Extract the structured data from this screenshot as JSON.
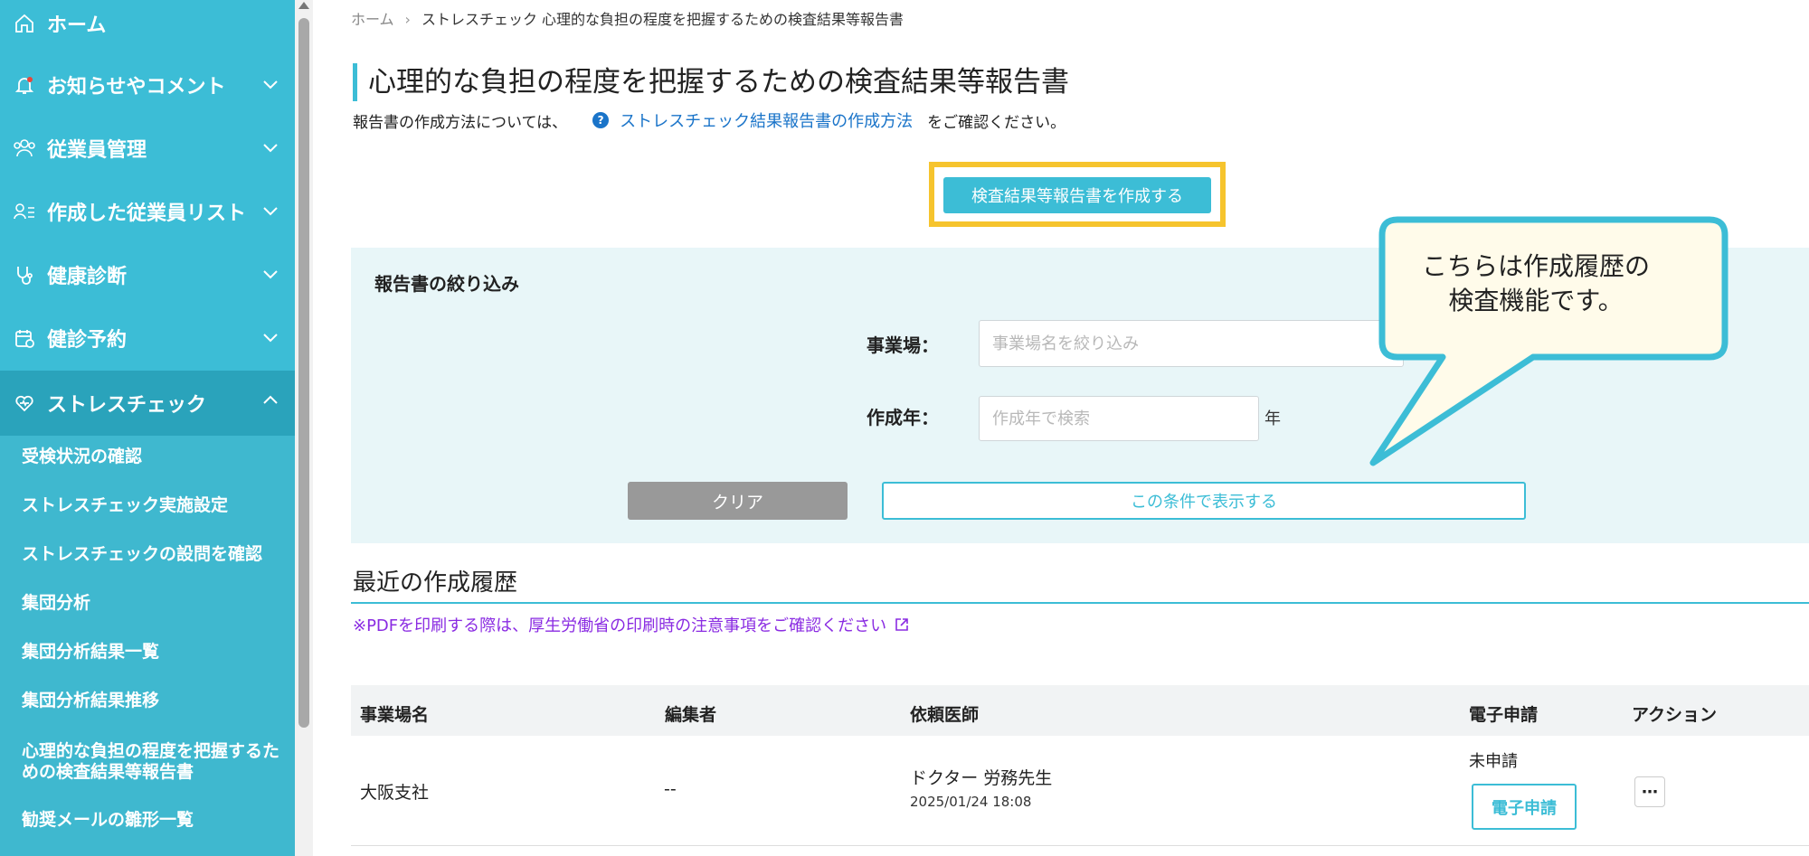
{
  "sidebar": {
    "items": [
      {
        "label": "ホーム",
        "icon": "home-icon"
      },
      {
        "label": "お知らせやコメント",
        "icon": "bell-icon"
      },
      {
        "label": "従業員管理",
        "icon": "users-icon"
      },
      {
        "label": "作成した従業員リスト",
        "icon": "user-list-icon"
      },
      {
        "label": "健康診断",
        "icon": "stethoscope-icon"
      },
      {
        "label": "健診予約",
        "icon": "calendar-icon"
      },
      {
        "label": "ストレスチェック",
        "icon": "heart-icon"
      }
    ],
    "sub_items": [
      "受検状況の確認",
      "ストレスチェック実施設定",
      "ストレスチェックの設問を確認",
      "集団分析",
      "集団分析結果一覧",
      "集団分析結果推移",
      "心理的な負担の程度を把握するための検査結果等報告書",
      "勧奨メールの雛形一覧"
    ]
  },
  "breadcrumb": {
    "home": "ホーム",
    "section": "ストレスチェック",
    "current": "心理的な負担の程度を把握するための検査結果等報告書"
  },
  "page": {
    "title": "心理的な負担の程度を把握するための検査結果等報告書",
    "intro_before": "報告書の作成方法については、",
    "intro_link": "ストレスチェック結果報告書の作成方法",
    "intro_after": "をご確認ください。",
    "create_button": "検査結果等報告書を作成する"
  },
  "filter": {
    "title": "報告書の絞り込み",
    "workplace_label": "事業場：",
    "workplace_placeholder": "事業場名を絞り込み",
    "year_label": "作成年：",
    "year_placeholder": "作成年で検索",
    "year_unit": "年",
    "clear_button": "クリア",
    "show_button": "この条件で表示する"
  },
  "callout": {
    "line1": "こちらは作成履歴の",
    "line2": "検査機能です。"
  },
  "history": {
    "title": "最近の作成履歴",
    "pdf_note": "※PDFを印刷する際は、厚生労働省の印刷時の注意事項をご確認ください",
    "columns": [
      "事業場名",
      "編集者",
      "依頼医師",
      "電子申請",
      "アクション"
    ],
    "rows": [
      {
        "workplace": "大阪支社",
        "editor": "--",
        "doctor": "ドクター 労務先生",
        "datetime": "2025/01/24 18:08",
        "status": "未申請",
        "esubmit_button": "電子申請",
        "more": "⋯"
      }
    ]
  },
  "colors": {
    "accent": "#3cbdd6",
    "highlight": "#f6c42d",
    "link": "#1a74c9",
    "note": "#8a2be2"
  }
}
